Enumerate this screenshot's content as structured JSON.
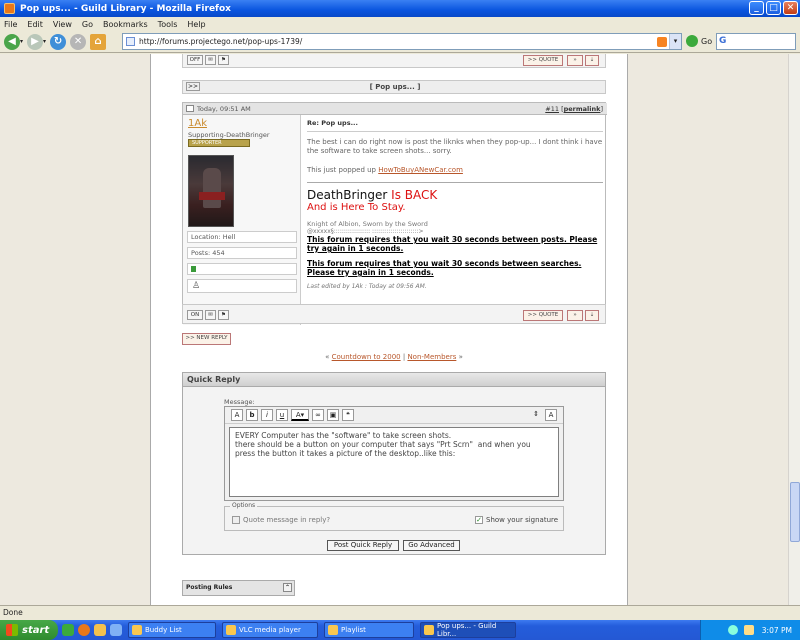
{
  "window": {
    "title": "Pop ups... - Guild Library - Mozilla Firefox"
  },
  "menu": [
    "File",
    "Edit",
    "View",
    "Go",
    "Bookmarks",
    "Tools",
    "Help"
  ],
  "nav": {
    "url": "http://forums.projectego.net/pop-ups-1739/",
    "go_label": "Go"
  },
  "top_buttons": {
    "off": "OFF",
    "quote": ">> QUOTE"
  },
  "thread_nav": {
    "title": "[ Pop ups... ]",
    "marker": ">>"
  },
  "post": {
    "date": "Today, 09:51 AM",
    "number": "#11",
    "permalink": "permalink",
    "author": "1Ak",
    "rank": "Supporting-DeathBringer",
    "badge": "SUPPORTER",
    "location": "Location: Hell",
    "posts": "Posts: 454",
    "subject": "Re: Pop ups...",
    "body": "The best i can do right now is post the liknks when they pop-up... I dont think i have the software to take screen shots... sorry.",
    "popped_prefix": "This just popped up",
    "popped_link": "HowToBuyANewCar.com",
    "sig_name": "DeathBringer",
    "sig_back": "Is BACK",
    "sig_line2": "And is Here To Stay.",
    "sig_knight": "Knight of Albion, Sworn by the Sword",
    "sig_deco": "@xxxxx§::::::::::::::::::  :::::::::::::::::::::::>",
    "warn1": "This forum requires that you wait 30 seconds between posts. Please try again in 1 seconds.",
    "warn2": "This forum requires that you wait 30 seconds between searches. Please try again in 1 seconds.",
    "edited": "Last edited by 1Ak : Today at 09:56 AM.",
    "on_btn": "ON",
    "quote_btn": ">> QUOTE"
  },
  "new_reply": ">> NEW REPLY",
  "links": {
    "prev_mark": "«",
    "prev": "Countdown to 2000",
    "sep": "|",
    "next": "Non-Members",
    "next_mark": "»"
  },
  "quick_reply": {
    "title": "Quick Reply",
    "message_label": "Message:",
    "text": "EVERY Computer has the \"software\" to take screen shots.\nthere should be a button on your computer that says \"Prt Scrn\"  and when you press the button it takes a picture of the desktop..like this:",
    "options_label": "Options",
    "quote_opt": "Quote message in reply?",
    "sig_opt": "Show your signature",
    "post_btn": "Post Quick Reply",
    "adv_btn": "Go Advanced"
  },
  "posting_rules": "Posting Rules",
  "status": "Done",
  "taskbar": {
    "start": "start",
    "tasks": [
      "Buddy List",
      "VLC media player",
      "Playlist",
      "Pop ups... - Guild Libr..."
    ],
    "time": "3:07 PM"
  }
}
